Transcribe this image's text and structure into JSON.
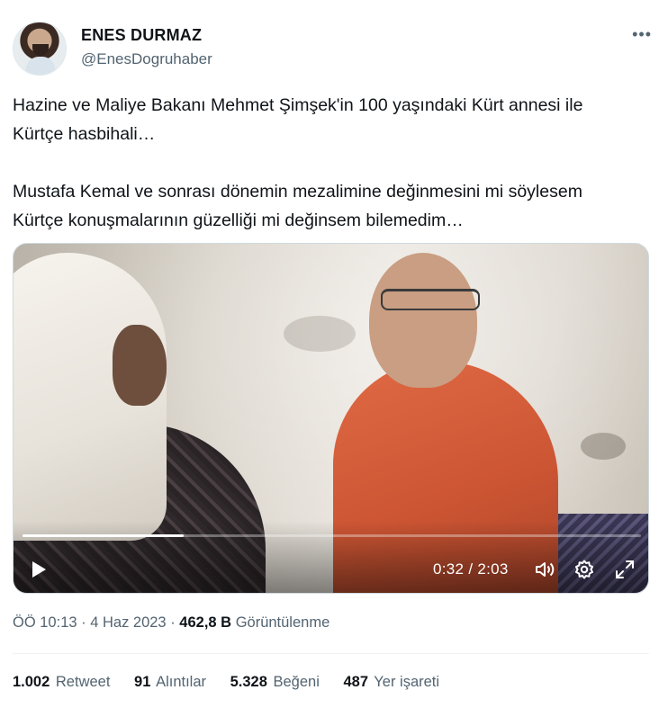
{
  "author": {
    "name": "ENES DURMAZ",
    "handle": "@EnesDogruhaber",
    "more_icon": "more-horizontal-icon"
  },
  "tweet": {
    "paragraph_1": "Hazine ve Maliye Bakanı Mehmet Şimşek'in 100 yaşındaki Kürt annesi ile\nKürtçe hasbihali…",
    "paragraph_2": "Mustafa Kemal ve sonrası dönemin mezalimine değinmesini mi söylesem\nKürtçe konuşmalarının güzelliği mi değinsem bilemedim…"
  },
  "video": {
    "current_time": "0:32",
    "separator": " / ",
    "duration": "2:03",
    "progress_fraction": 0.26,
    "icons": [
      "play-icon",
      "volume-icon",
      "settings-gear-icon",
      "fullscreen-icon"
    ]
  },
  "meta": {
    "time": "ÖÖ 10:13",
    "dot1": " · ",
    "date": "4 Haz 2023",
    "dot2": " · ",
    "views_count": "462,8 B",
    "views_label": "Görüntülenme"
  },
  "stats": {
    "retweets_count": "1.002",
    "retweets_label": "Retweet",
    "quotes_count": "91",
    "quotes_label": "Alıntılar",
    "likes_count": "5.328",
    "likes_label": "Beğeni",
    "bookmarks_count": "487",
    "bookmarks_label": "Yer işareti"
  },
  "colors": {
    "text_primary": "#0f1419",
    "text_secondary": "#536471",
    "divider": "#eff3f4"
  }
}
